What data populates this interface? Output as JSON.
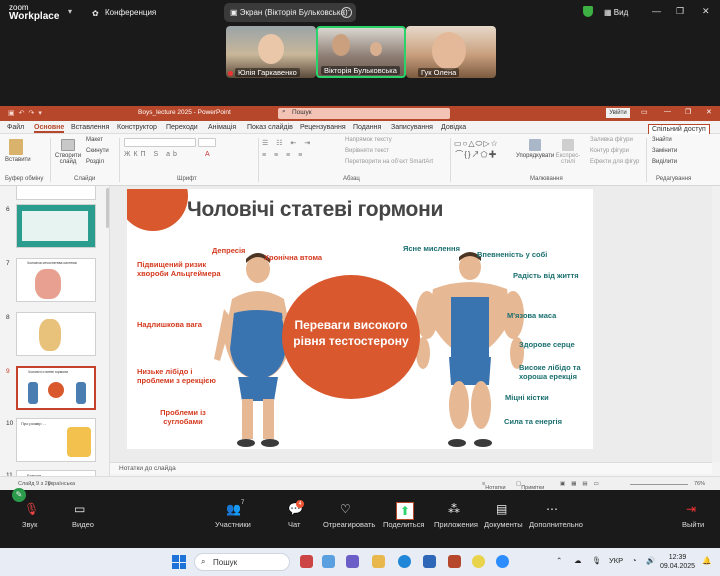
{
  "zoom": {
    "logo_line1": "zoom",
    "logo_line2": "Workplace",
    "meeting_label": "Конференция",
    "screen_share_label": "Экран (Вікторія Бульковська)",
    "view_label": "Вид",
    "participants": [
      {
        "name": "Юлія Гаркавенко",
        "muted": true
      },
      {
        "name": "Вікторія Бульковська",
        "active": true
      },
      {
        "name": "Гук Олена",
        "muted": false
      }
    ],
    "toolbar": {
      "audio": "Звук",
      "video": "Видео",
      "participants": "Участники",
      "participants_count": "7",
      "chat": "Чат",
      "chat_badge": "4",
      "react": "Отреагировать",
      "share": "Поделиться",
      "apps": "Приложения",
      "docs": "Документы",
      "more": "Дополнительно",
      "leave": "Выйти"
    }
  },
  "powerpoint": {
    "file_name": "Boys_lecture 2025  -  PowerPoint",
    "search_placeholder": "Пошук",
    "sign_in": "Увійти",
    "share_label": "Спільний доступ",
    "menu": [
      "Файл",
      "Основне",
      "Вставлення",
      "Конструктор",
      "Переходи",
      "Анімація",
      "Показ слайдів",
      "Рецензування",
      "Подання",
      "Записування",
      "Довідка"
    ],
    "active_menu": "Основне",
    "ribbon": {
      "paste": "Вставити",
      "clipboard_group": "Буфер обміну",
      "create_slide": "Створити слайд",
      "layout": "Макет",
      "reset": "Скинути",
      "section": "Розділ",
      "slides_group": "Слайди",
      "font_group": "Шрифт",
      "paragraph_group": "Абзац",
      "text_direction": "Напрямок тексту",
      "align_text": "Вирівняти текст",
      "smartart": "Перетворити на обʼєкт SmartArt",
      "arrange": "Упорядкувати",
      "quick_styles": "Експрес-стилі",
      "drawing_group": "Малювання",
      "fill": "Заливка фігури",
      "outline": "Контур фігури",
      "effects": "Ефекти для фігур",
      "find": "Знайти",
      "replace": "Замінити",
      "select": "Виділити",
      "editing_group": "Редагування"
    },
    "thumbnails": [
      {
        "num": "6",
        "title": ""
      },
      {
        "num": "7",
        "title": "Чоловіча сечостатева система"
      },
      {
        "num": "8",
        "title": ""
      },
      {
        "num": "9",
        "title": "Чоловічі статеві гормони",
        "selected": true
      },
      {
        "num": "10",
        "title": "Про розмір ..."
      },
      {
        "num": "11",
        "title": "Ерекція"
      }
    ],
    "slide": {
      "title": "Чоловічі статеві гормони",
      "center_text": "Переваги високого рівня тестостерону",
      "left_labels": [
        "Депресія",
        "Хронічна втома",
        "Підвищений ризик хвороби Альцгеймера",
        "Надлишкова вага",
        "Низьке лібідо і проблеми з ерекцією",
        "Проблеми із суглобами"
      ],
      "right_labels": [
        "Ясне мислення",
        "Впевненість у собі",
        "Радість від життя",
        "М'язова маса",
        "Здорове серце",
        "Високе лібідо та хороша ерекція",
        "Міцні кістки",
        "Сила та енергія"
      ]
    },
    "notes_placeholder": "Нотатки до слайда",
    "status": {
      "slide_info": "Слайд 9 з 28",
      "language": "українська",
      "notes": "Нотатки",
      "comments": "Примітки",
      "zoom": "76%"
    }
  },
  "taskbar": {
    "search": "Пошук",
    "lang": "УКР",
    "time": "12:39",
    "date": "09.04.2025"
  },
  "colors": {
    "ppt_accent": "#b7472a",
    "slide_orange": "#d9582e",
    "label_red": "#d43a1f",
    "label_green": "#1b6f6f"
  }
}
